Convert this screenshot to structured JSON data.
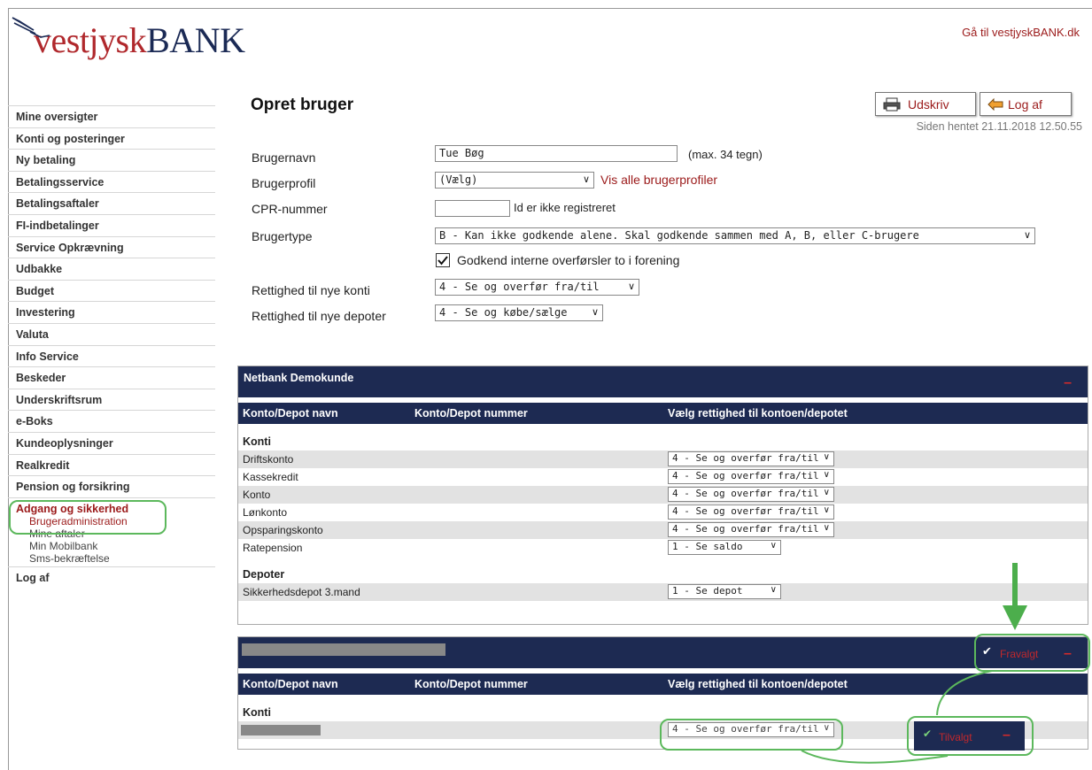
{
  "header": {
    "logo_text_1": "vestjysk",
    "logo_text_2": "BANK",
    "top_link": "Gå til vestjyskBANK.dk"
  },
  "sidebar": {
    "items": [
      {
        "label": "Mine oversigter"
      },
      {
        "label": "Konti og posteringer"
      },
      {
        "label": "Ny betaling"
      },
      {
        "label": "Betalingsservice"
      },
      {
        "label": "Betalingsaftaler"
      },
      {
        "label": "FI-indbetalinger"
      },
      {
        "label": "Service Opkrævning"
      },
      {
        "label": "Udbakke"
      },
      {
        "label": "Budget"
      },
      {
        "label": "Investering"
      },
      {
        "label": "Valuta"
      },
      {
        "label": "Info Service"
      },
      {
        "label": "Beskeder"
      },
      {
        "label": "Underskriftsrum"
      },
      {
        "label": "e-Boks"
      },
      {
        "label": "Kundeoplysninger"
      },
      {
        "label": "Realkredit"
      },
      {
        "label": "Pension og forsikring"
      },
      {
        "label": "Adgang og sikkerhed"
      }
    ],
    "sub_items": [
      {
        "label": "Brugeradministration"
      },
      {
        "label": "Mine aftaler"
      },
      {
        "label": "Min Mobilbank"
      },
      {
        "label": "Sms-bekræftelse"
      }
    ],
    "logout": "Log af"
  },
  "main": {
    "title": "Opret bruger",
    "print_label": "Udskriv",
    "logout_label": "Log af",
    "fetched": "Siden hentet 21.11.2018 12.50.55"
  },
  "form": {
    "username_label": "Brugernavn",
    "username_value": "Tue Bøg",
    "username_hint": "(max. 34 tegn)",
    "profile_label": "Brugerprofil",
    "profile_value": "(Vælg)",
    "profile_link": "Vis alle brugerprofiler",
    "cpr_label": "CPR-nummer",
    "cpr_value": "",
    "cpr_note": "Id er ikke registreret",
    "type_label": "Brugertype",
    "type_value": "B - Kan ikke godkende alene. Skal godkende sammen med A, B, eller C-brugere",
    "approve_label": "Godkend interne overførsler to i forening",
    "new_accounts_label": "Rettighed til nye konti",
    "new_accounts_value": "4 - Se og overfør fra/til",
    "new_depots_label": "Rettighed til nye depoter",
    "new_depots_value": "4 - Se og købe/sælge"
  },
  "panel1": {
    "title": "Netbank Demokunde",
    "col1": "Konto/Depot navn",
    "col2": "Konto/Depot nummer",
    "col3": "Vælg rettighed til kontoen/depotet",
    "section_accounts": "Konti",
    "accounts": [
      {
        "name": "Driftskonto",
        "value": "4 - Se og overfør fra/til"
      },
      {
        "name": "Kassekredit",
        "value": "4 - Se og overfør fra/til"
      },
      {
        "name": "Konto",
        "value": "4 - Se og overfør fra/til"
      },
      {
        "name": "Lønkonto",
        "value": "4 - Se og overfør fra/til"
      },
      {
        "name": "Opsparingskonto",
        "value": "4 - Se og overfør fra/til"
      },
      {
        "name": "Ratepension",
        "value": "1 - Se saldo"
      }
    ],
    "section_depots": "Depoter",
    "depots": [
      {
        "name": "Sikkerhedsdepot 3.mand",
        "value": "1 - Se depot"
      }
    ]
  },
  "panel2": {
    "deselected_label": "Fravalgt",
    "col1": "Konto/Depot navn",
    "col2": "Konto/Depot nummer",
    "col3": "Vælg rettighed til kontoen/depotet",
    "section_accounts": "Konti",
    "account_value": "4 - Se og overfør fra/til",
    "selected_label": "Tilvalgt"
  },
  "colors": {
    "navy": "#1d2a52",
    "brand_red": "#9b1a1a",
    "highlight_green": "#5cb85c"
  }
}
